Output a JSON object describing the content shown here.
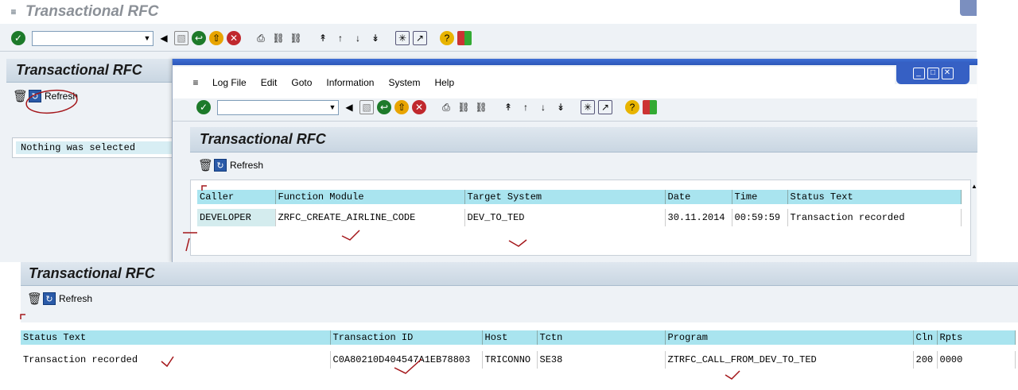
{
  "back_window": {
    "title": "Transactional RFC",
    "panel_title": "Transactional RFC",
    "refresh_label": "Refresh",
    "empty_message": "Nothing was selected"
  },
  "front_window": {
    "menu": [
      "Log File",
      "Edit",
      "Goto",
      "Information",
      "System",
      "Help"
    ],
    "panel_title": "Transactional RFC",
    "refresh_label": "Refresh",
    "table": {
      "headers": [
        "Caller",
        "Function Module",
        "Target System",
        "Date",
        "Time",
        "Status Text"
      ],
      "rows": [
        [
          "DEVELOPER",
          "ZRFC_CREATE_AIRLINE_CODE",
          "DEV_TO_TED",
          "30.11.2014",
          "00:59:59",
          "Transaction recorded"
        ]
      ]
    }
  },
  "bottom_window": {
    "panel_title": "Transactional RFC",
    "refresh_label": "Refresh",
    "table": {
      "headers": [
        "Status Text",
        "Transaction ID",
        "Host",
        "Tctn",
        "Program",
        "Cln",
        "Rpts"
      ],
      "rows": [
        [
          "Transaction recorded",
          "C0A80210D404547A1EB78803",
          "TRICONNO",
          "SE38",
          "ZTRFC_CALL_FROM_DEV_TO_TED",
          "200",
          "0000"
        ]
      ]
    }
  },
  "window_controls": {
    "minimize": "_",
    "maximize": "□",
    "close": "✕"
  }
}
